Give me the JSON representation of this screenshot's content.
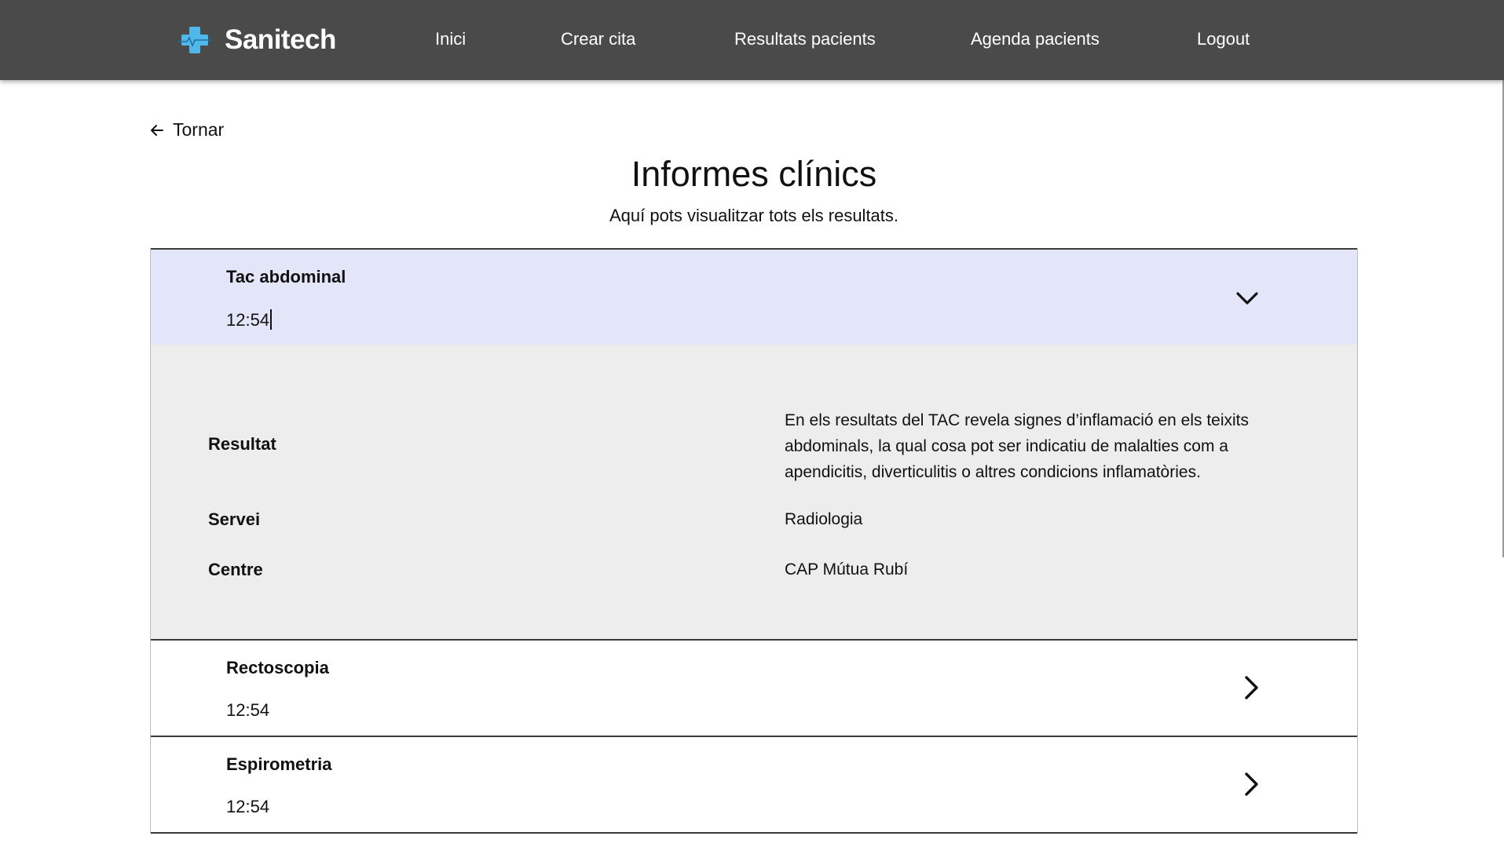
{
  "header": {
    "brand_name": "Sanitech",
    "logo_icon": "medical-cross-icon",
    "brand_color": "#4fb8e8",
    "background": "#4a4a4a",
    "nav": [
      {
        "label": "Inici"
      },
      {
        "label": "Crear cita"
      },
      {
        "label": "Resultats pacients"
      },
      {
        "label": "Agenda pacients"
      },
      {
        "label": "Logout"
      }
    ]
  },
  "back": {
    "label": "Tornar",
    "icon": "arrow-left-icon"
  },
  "page": {
    "title": "Informes clínics",
    "subtitle": "Aquí pots visualitzar tots els resultats."
  },
  "reports": [
    {
      "name": "Tac abdominal",
      "time": "12:54",
      "expanded": true,
      "icon": "chevron-down-icon",
      "details": {
        "result_label": "Resultat",
        "result_value": "En els resultats del TAC revela signes d’inflamació en els teixits abdominals, la qual cosa pot ser indicatiu de malalties com a apendicitis, diverticulitis o altres condicions inflamatòries.",
        "service_label": "Servei",
        "service_value": "Radiologia",
        "centre_label": "Centre",
        "centre_value": "CAP Mútua Rubí"
      }
    },
    {
      "name": "Rectoscopia",
      "time": "12:54",
      "expanded": false,
      "icon": "chevron-right-icon"
    },
    {
      "name": "Espirometria",
      "time": "12:54",
      "expanded": false,
      "icon": "chevron-right-icon"
    }
  ],
  "colors": {
    "header_bg": "#4a4a4a",
    "open_header_bg": "#e3e5f8",
    "body_bg": "#ededed"
  }
}
